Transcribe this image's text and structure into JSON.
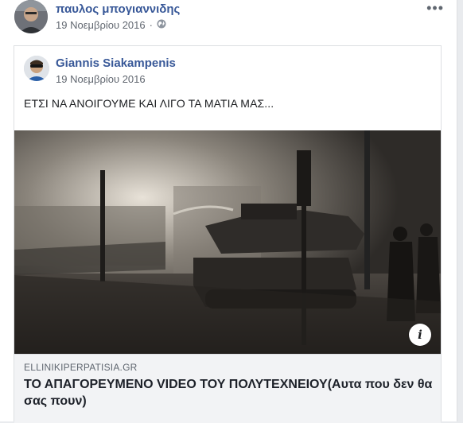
{
  "post": {
    "author": "παυλος μπογιαννιδης",
    "date": "19 Νοεμβρίου 2016",
    "privacy_icon": "globe-icon",
    "menu_label": "•••"
  },
  "shared_post": {
    "author": "Giannis Siakampenis",
    "date": "19 Νοεμβρίου 2016",
    "text": "ΕΤΣΙ ΝΑ ΑΝΟΙΓΟΥΜΕ ΚΑΙ ΛΙΓΟ ΤΑ ΜΑΤΙΑ ΜΑΣ..."
  },
  "link": {
    "domain": "ELLINIKIPERPATISIA.GR",
    "title": "ΤΟ ΑΠΑΓΟΡΕΥΜΕΝΟ VIDEO ΤΟΥ ΠΟΛΥΤΕΧΝΕΙΟΥ(Αυτα που δεν θα σας πουν)",
    "info_label": "i"
  },
  "colors": {
    "author_link": "#385898",
    "meta_text": "#616770",
    "card_footer": "#f2f3f5",
    "page_bg": "#e9ebee"
  }
}
